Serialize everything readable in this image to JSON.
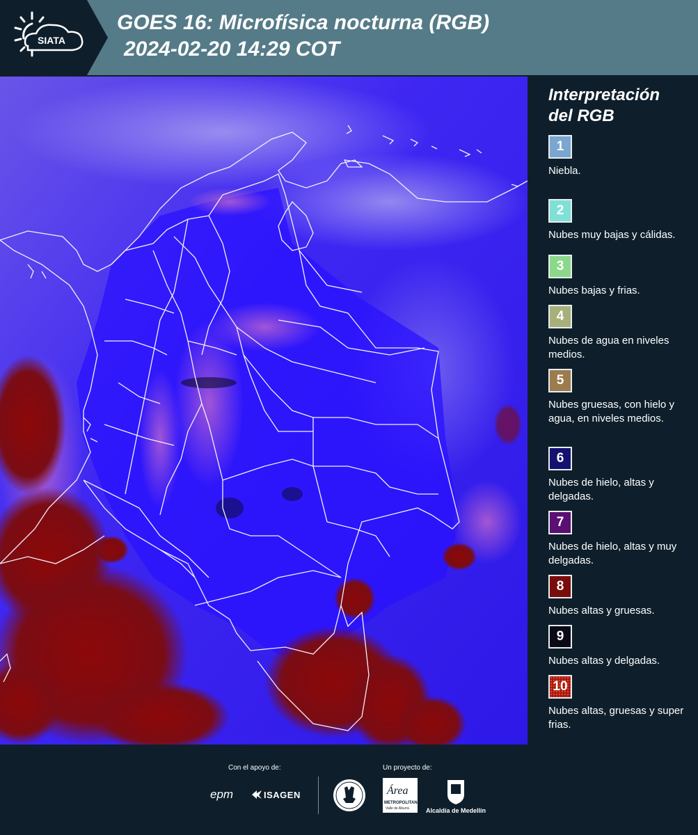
{
  "header": {
    "logo_text": "SIATA",
    "title_line1": "GOES 16: Microfísica nocturna (RGB)",
    "title_line2": "2024-02-20 14:29 COT",
    "background": "#557b88"
  },
  "map": {
    "description_colors": {
      "base": "#3a1ff0",
      "land": "#2a10ff",
      "storm": "#8a0b0b",
      "pinkish": "#c06ad0"
    }
  },
  "legend": {
    "title_line1": "Interpretación",
    "title_line2": "del RGB",
    "items": [
      {
        "number": "1",
        "label": "Niebla.",
        "color": "#7aa6cf"
      },
      {
        "number": "2",
        "label": "Nubes muy bajas y cálidas.",
        "color": "#7fe0d8"
      },
      {
        "number": "3",
        "label": "Nubes bajas y frias.",
        "color": "#8bd88a"
      },
      {
        "number": "4",
        "label": "Nubes de agua en niveles medios.",
        "color": "#a7b07a"
      },
      {
        "number": "5",
        "label": "Nubes gruesas, con hielo y agua, en niveles medios.",
        "color": "#9c7b4e"
      },
      {
        "number": "6",
        "label": "Nubes de hielo, altas y delgadas.",
        "color": "#141171"
      },
      {
        "number": "7",
        "label": "Nubes de hielo, altas y muy delgadas.",
        "color": "#5a0f72"
      },
      {
        "number": "8",
        "label": "Nubes altas y gruesas.",
        "color": "#7a0c0c"
      },
      {
        "number": "9",
        "label": "Nubes altas y delgadas.",
        "color": "#0a0a16"
      },
      {
        "number": "10",
        "label": "Nubes altas, gruesas y super frias.",
        "color": "#a2180e"
      }
    ]
  },
  "footer": {
    "support_label": "Con el apoyo de:",
    "project_label": "Un proyecto de:",
    "epm": "epm",
    "isagen": "ISAGEN",
    "area_name": "Área",
    "area_sub1": "METROPOLITANA",
    "area_sub2": "Valle de Aburrá",
    "alcaldia": "Alcaldía de Medellín"
  }
}
